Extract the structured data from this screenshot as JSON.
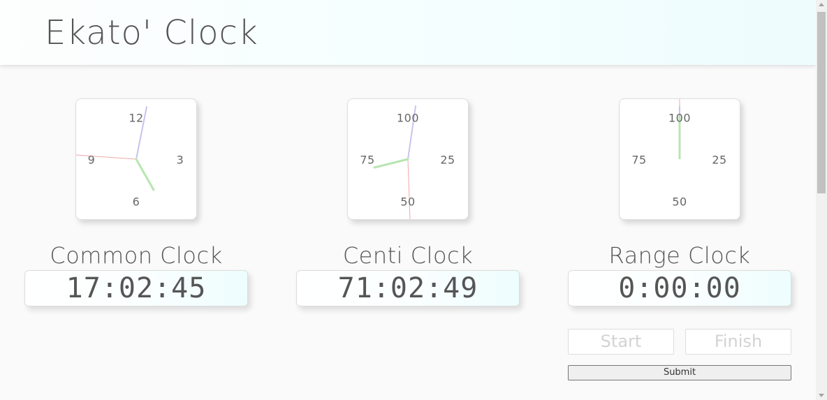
{
  "header": {
    "title": "Ekato' Clock"
  },
  "clocks": {
    "common": {
      "label": "Common Clock",
      "time": "17:02:45",
      "numbers": {
        "top": "12",
        "right": "3",
        "bottom": "6",
        "left": "9"
      }
    },
    "centi": {
      "label": "Centi Clock",
      "time": "71:02:49",
      "numbers": {
        "top": "100",
        "right": "25",
        "bottom": "50",
        "left": "75"
      }
    },
    "range": {
      "label": "Range Clock",
      "time": "0:00:00",
      "numbers": {
        "top": "100",
        "right": "25",
        "bottom": "50",
        "left": "75"
      }
    }
  },
  "controls": {
    "start_label": "Start",
    "finish_label": "Finish",
    "submit_label": "Submit"
  },
  "colors": {
    "hour_hand": "#b7e6b1",
    "minute_hand": "#c9c3ef",
    "second_hand": "#f2a8a8"
  }
}
